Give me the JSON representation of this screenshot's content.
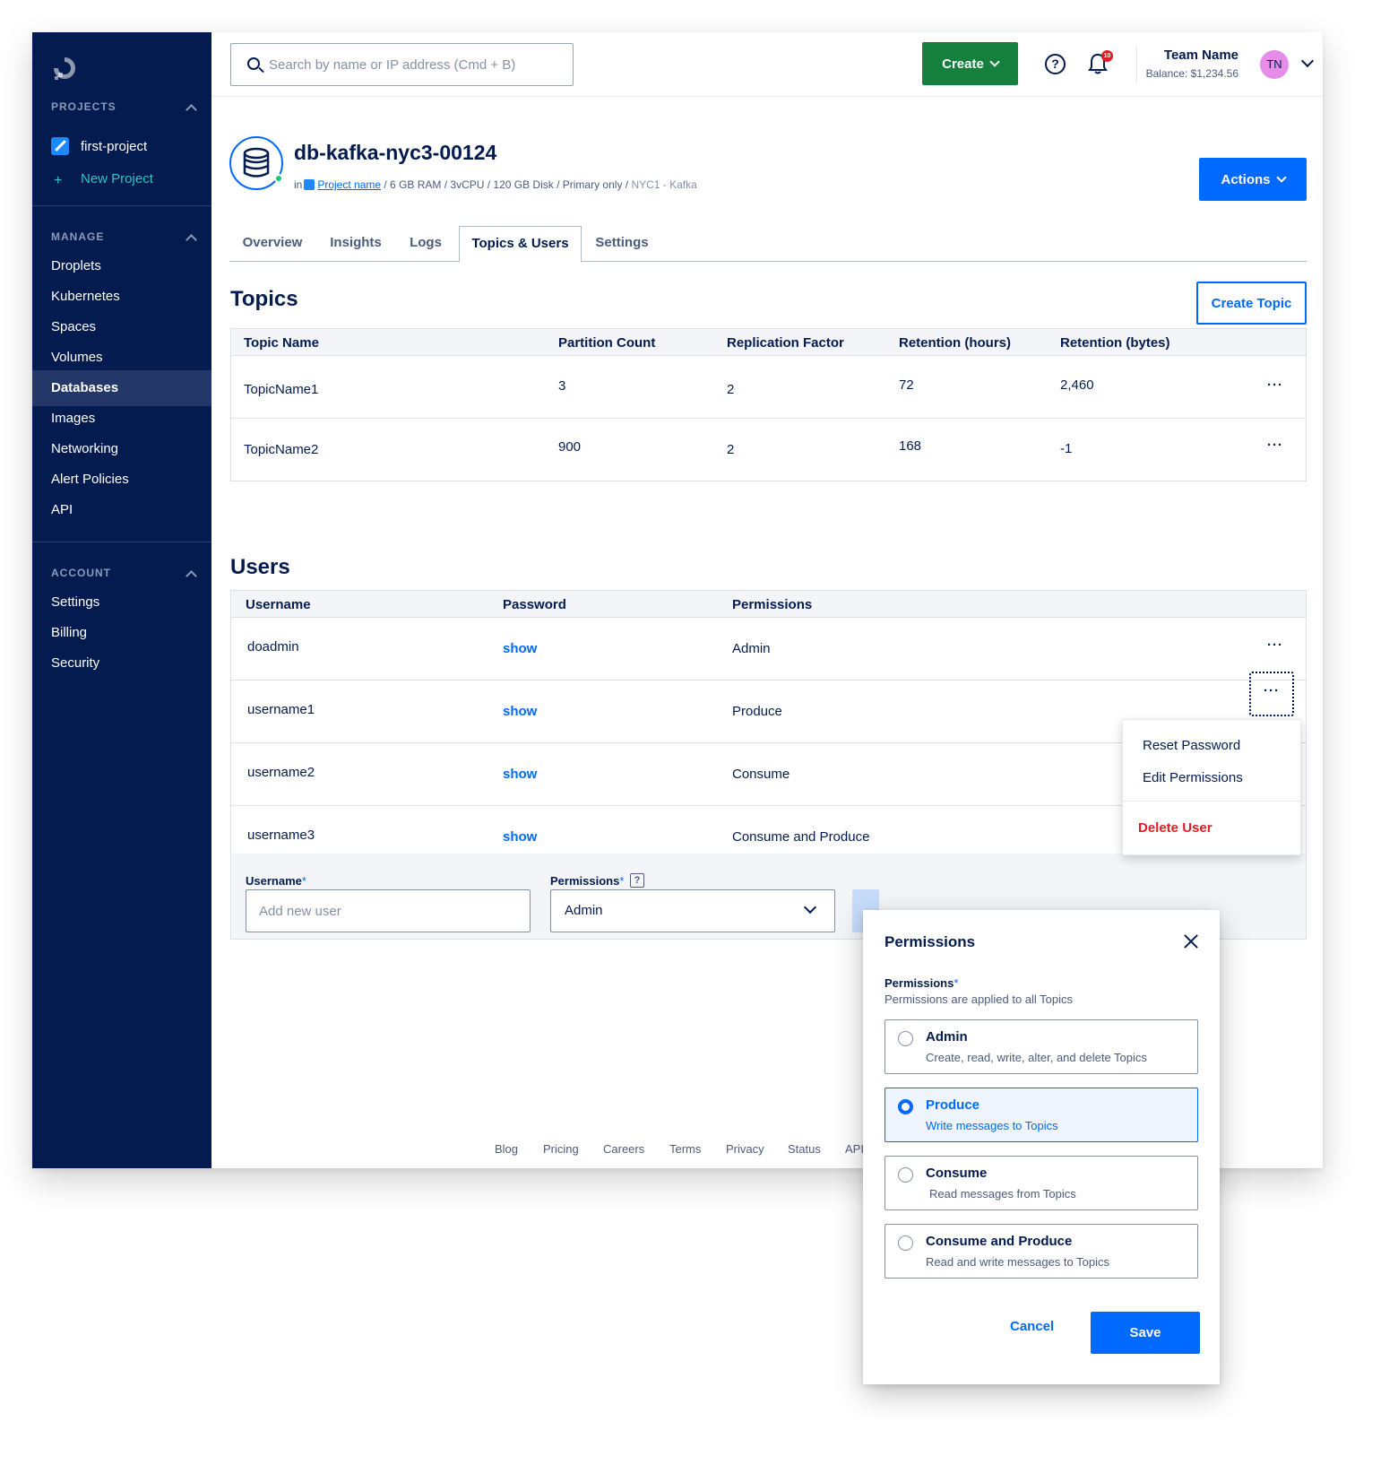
{
  "search": {
    "placeholder": "Search by name or IP address (Cmd + B)"
  },
  "topbar": {
    "create_label": "Create",
    "notification_count": "10",
    "team_name": "Team Name",
    "balance": "Balance: $1,234.56",
    "avatar_initials": "TN"
  },
  "sidebar": {
    "projects_title": "PROJECTS",
    "projects": [
      {
        "label": "first-project"
      },
      {
        "label": "New Project"
      }
    ],
    "manage_title": "MANAGE",
    "manage_items": [
      {
        "label": "Droplets"
      },
      {
        "label": "Kubernetes"
      },
      {
        "label": "Spaces"
      },
      {
        "label": "Volumes"
      },
      {
        "label": "Databases",
        "active": true
      },
      {
        "label": "Images"
      },
      {
        "label": "Networking"
      },
      {
        "label": "Alert Policies"
      },
      {
        "label": "API"
      }
    ],
    "account_title": "ACCOUNT",
    "account_items": [
      {
        "label": "Settings"
      },
      {
        "label": "Billing"
      },
      {
        "label": "Security"
      }
    ]
  },
  "header": {
    "title": "db-kafka-nyc3-00124",
    "in_label": "in",
    "project_link": "Project name",
    "meta": " / 6 GB RAM / 3vCPU / 120 GB Disk / Primary only / ",
    "region": "NYC1 - Kafka",
    "actions_label": "Actions"
  },
  "tabs": [
    {
      "label": "Overview"
    },
    {
      "label": "Insights"
    },
    {
      "label": "Logs"
    },
    {
      "label": "Topics & Users",
      "active": true
    },
    {
      "label": "Settings"
    }
  ],
  "topics": {
    "title": "Topics",
    "create_label": "Create Topic",
    "columns": [
      "Topic Name",
      "Partition Count",
      "Replication Factor",
      "Retention (hours)",
      "Retention (bytes)"
    ],
    "rows": [
      {
        "name": "TopicName1",
        "partitions": "3",
        "replication": "2",
        "retention_hours": "72",
        "retention_bytes": "2,460"
      },
      {
        "name": "TopicName2",
        "partitions": "900",
        "replication": "2",
        "retention_hours": "168",
        "retention_bytes": "-1"
      }
    ],
    "more_label": "···"
  },
  "users": {
    "title": "Users",
    "columns": [
      "Username",
      "Password",
      "Permissions"
    ],
    "rows": [
      {
        "username": "doadmin",
        "password": "show",
        "permissions": "Admin"
      },
      {
        "username": "username1",
        "password": "show",
        "permissions": "Produce"
      },
      {
        "username": "username2",
        "password": "show",
        "permissions": "Consume"
      },
      {
        "username": "username3",
        "password": "show",
        "permissions": "Consume and Produce"
      }
    ],
    "more_label": "···"
  },
  "add_user": {
    "username_label": "Username",
    "username_placeholder": "Add new user",
    "permissions_label": "Permissions",
    "required_mark": "*",
    "help_mark": "?",
    "permissions_value": "Admin"
  },
  "user_menu": {
    "items": [
      {
        "label": "Reset Password"
      },
      {
        "label": "Edit Permissions"
      },
      {
        "label": "Delete User"
      }
    ]
  },
  "footer": {
    "links": [
      "Blog",
      "Pricing",
      "Careers",
      "Terms",
      "Privacy",
      "Status",
      "API"
    ]
  },
  "modal": {
    "title": "Permissions",
    "field_label": "Permissions",
    "required_mark": "*",
    "hint": "Permissions are applied to all Topics",
    "options": [
      {
        "title": "Admin",
        "desc": "Create, read, write, alter, and delete Topics",
        "selected": false
      },
      {
        "title": "Produce",
        "desc": "Write messages to Topics",
        "selected": true
      },
      {
        "title": "Consume",
        "desc": "Read messages from Topics",
        "selected": false
      },
      {
        "title": "Consume and Produce",
        "desc": "Read and write messages to Topics",
        "selected": false
      }
    ],
    "cancel_label": "Cancel",
    "save_label": "Save"
  },
  "colors": {
    "sidebar_bg": "#031b4e",
    "primary": "#0069ff",
    "create_green": "#15803d",
    "danger": "#e11d24"
  }
}
